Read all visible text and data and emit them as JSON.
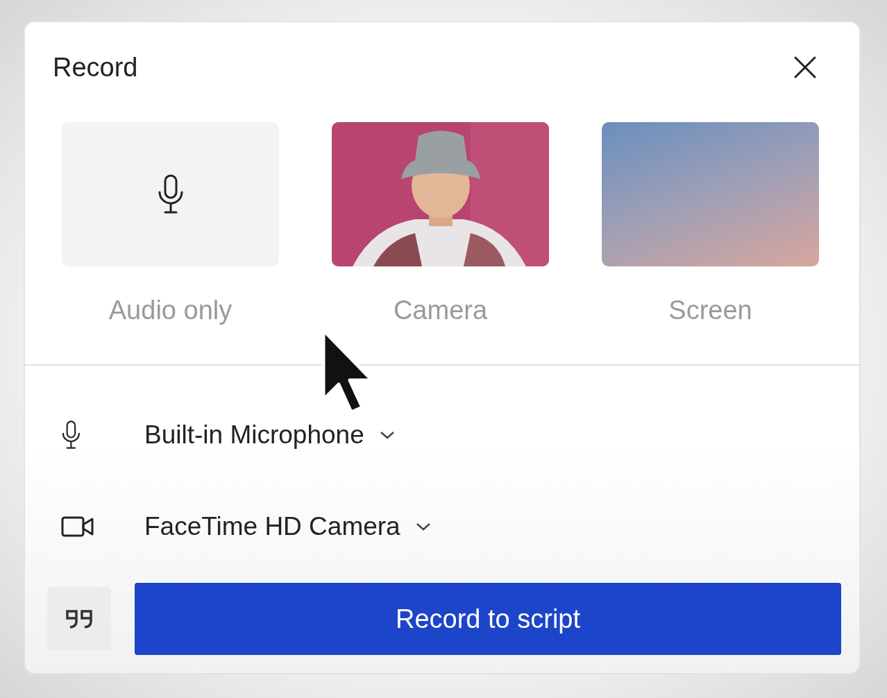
{
  "dialog": {
    "title": "Record"
  },
  "modes": [
    {
      "kind": "icon",
      "label": "Audio only"
    },
    {
      "kind": "picture",
      "label": "Camera"
    },
    {
      "kind": "gradient",
      "label": "Screen"
    }
  ],
  "devices": [
    {
      "kind": "microphone",
      "label": "Built-in Microphone"
    },
    {
      "kind": "camera",
      "label": "FaceTime HD Camera"
    }
  ],
  "record_button": {
    "label": "Record to script"
  }
}
